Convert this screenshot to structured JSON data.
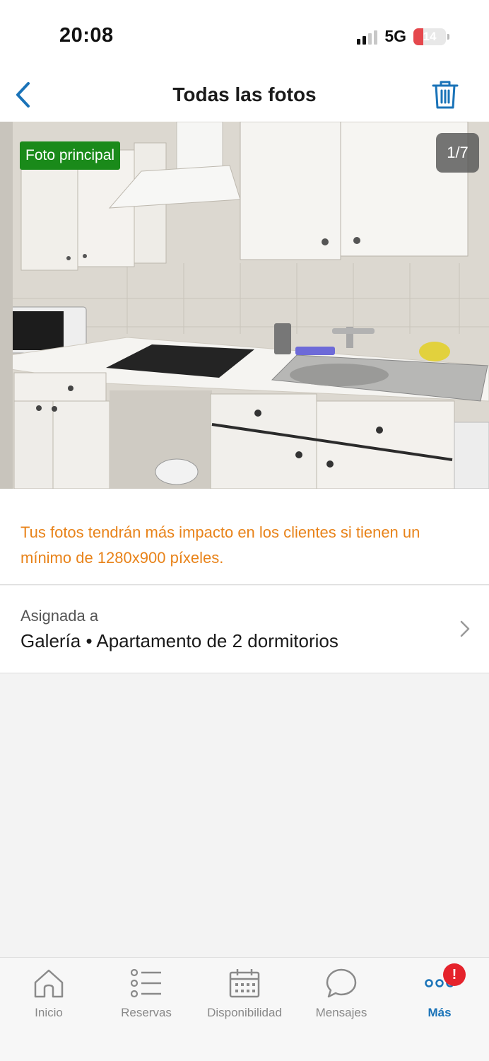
{
  "status_bar": {
    "time": "20:08",
    "network": "5G",
    "battery": "14"
  },
  "header": {
    "title": "Todas las fotos",
    "back_icon": "chevron-left-icon",
    "delete_icon": "trash-icon"
  },
  "photo": {
    "badge": "Foto principal",
    "counter": "1/7"
  },
  "tip": {
    "text": "Tus fotos tendrán más impacto en los clientes si tienen un mínimo de 1280x900 píxeles."
  },
  "assigned": {
    "label": "Asignada a",
    "value": "Galería • Apartamento de 2 dormitorios"
  },
  "tabs": [
    {
      "label": "Inicio",
      "icon": "home-icon"
    },
    {
      "label": "Reservas",
      "icon": "list-icon"
    },
    {
      "label": "Disponibilidad",
      "icon": "calendar-icon"
    },
    {
      "label": "Mensajes",
      "icon": "chat-bubble-icon"
    },
    {
      "label": "Más",
      "icon": "more-dots-icon",
      "badge": "!",
      "active": true
    }
  ],
  "colors": {
    "accent": "#1a73b8",
    "tip": "#e8831a",
    "badge_green": "#1a8a1a",
    "alert_red": "#e5232c"
  }
}
